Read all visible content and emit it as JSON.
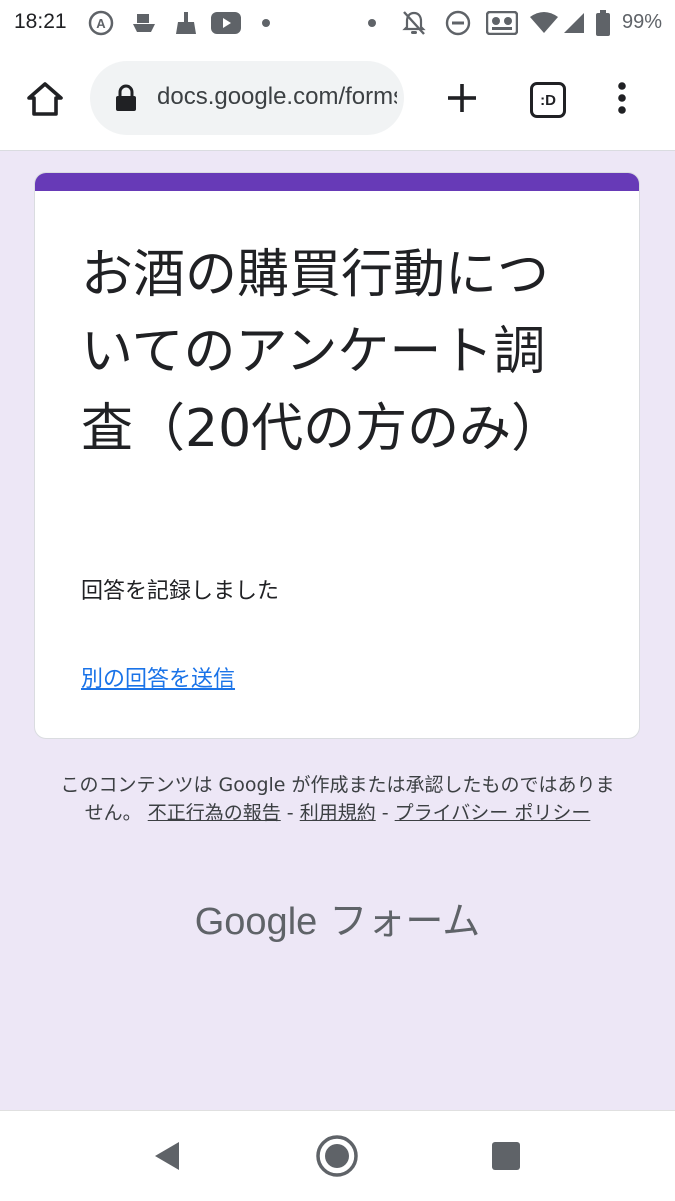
{
  "status_bar": {
    "time": "18:21",
    "battery": "99%",
    "icons": [
      "app-a-icon",
      "ship-icon",
      "broom-icon",
      "youtube-icon",
      "dot-icon",
      "dot-icon",
      "notifications-off-icon",
      "do-not-disturb-icon",
      "cast-icon",
      "wifi-icon",
      "signal-icon",
      "battery-icon"
    ]
  },
  "browser": {
    "url": "docs.google.com/forms/",
    "tab_count": ":D",
    "icons": [
      "home-icon",
      "lock-icon",
      "new-tab-icon",
      "menu-icon"
    ]
  },
  "form": {
    "accent_color": "#673ab7",
    "title": "お酒の購買行動についてのアンケート調査（20代の方のみ）",
    "confirmation": "回答を記録しました",
    "resubmit_link": "別の回答を送信"
  },
  "footer": {
    "disclaimer_text": "このコンテンツは Google が作成または承認したものではありません。",
    "report_abuse": "不正行為の報告",
    "separator": "-",
    "terms": "利用規約",
    "privacy": "プライバシー ポリシー",
    "logo_google": "Google",
    "logo_forms": "フォーム"
  },
  "background_color": "#ede7f6"
}
